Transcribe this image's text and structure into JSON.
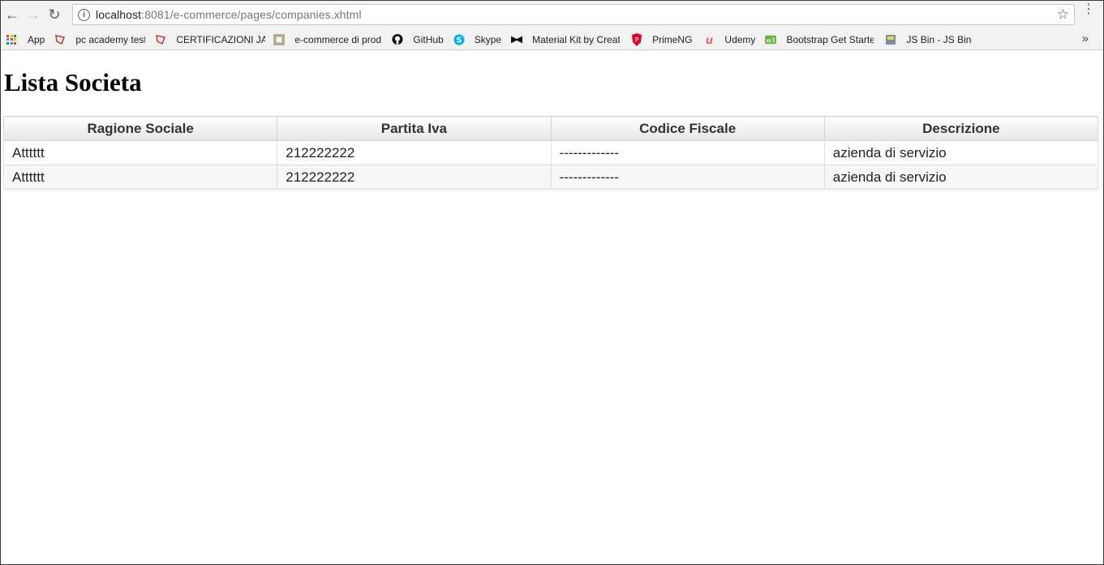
{
  "browser": {
    "url_host": "localhost",
    "url_rest": ":8081/e-commerce/pages/companies.xhtml",
    "bookmarks": [
      {
        "label": "App",
        "icon": "apps-grid-icon"
      },
      {
        "label": "pc academy test",
        "icon": "bookmark-folder-icon"
      },
      {
        "label": "CERTIFICAZIONI JAV",
        "icon": "bookmark-folder-icon"
      },
      {
        "label": "e-commerce di prod",
        "icon": "bookmark-page-icon"
      },
      {
        "label": "GitHub",
        "icon": "github-icon"
      },
      {
        "label": "Skype",
        "icon": "skype-icon"
      },
      {
        "label": "Material Kit by Creat",
        "icon": "bowtie-icon"
      },
      {
        "label": "PrimeNG",
        "icon": "primeng-shield-icon"
      },
      {
        "label": "Udemy",
        "icon": "udemy-icon"
      },
      {
        "label": "Bootstrap Get Starte",
        "icon": "bootstrap-icon"
      },
      {
        "label": "JS Bin - JS Bin",
        "icon": "jsbin-icon"
      }
    ]
  },
  "page": {
    "title": "Lista Societa"
  },
  "table": {
    "columns": [
      "Ragione Sociale",
      "Partita Iva",
      "Codice Fiscale",
      "Descrizione"
    ],
    "rows": [
      [
        "Atttttt",
        "212222222",
        "-------------",
        "azienda di servizio"
      ],
      [
        "Atttttt",
        "212222222",
        "-------------",
        "azienda di servizio"
      ]
    ]
  }
}
